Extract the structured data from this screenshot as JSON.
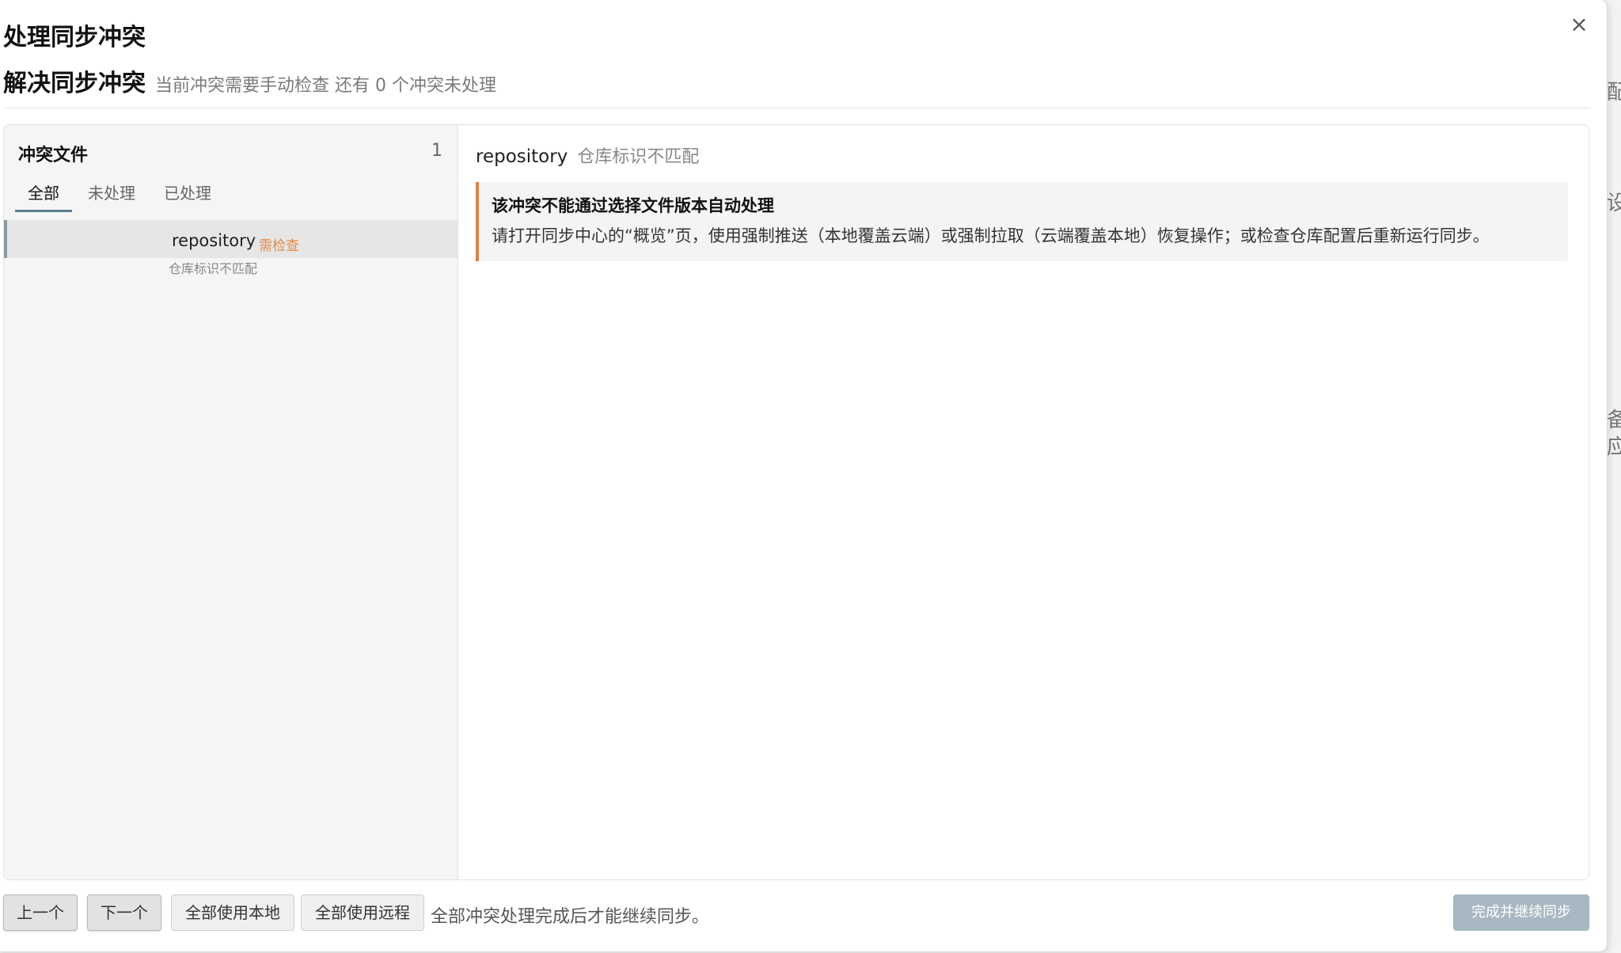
{
  "dialog": {
    "title": "处理同步冲突",
    "close_glyph": "×"
  },
  "heading": {
    "main": "解决同步冲突",
    "sub": "当前冲突需要手动检查  还有 0 个冲突未处理"
  },
  "file_list": {
    "title": "冲突文件",
    "count": "1",
    "tabs": [
      "全部",
      "未处理",
      "已处理"
    ],
    "active_tab": "全部",
    "items": [
      {
        "name": "repository",
        "badge": "需检查",
        "reason": "仓库标识不匹配",
        "badge_color": "#e08a4a"
      }
    ]
  },
  "detail": {
    "name": "repository",
    "reason": "仓库标识不匹配",
    "notice_title": "该冲突不能通过选择文件版本自动处理",
    "notice_body": "请打开同步中心的“概览”页，使用强制推送（本地覆盖云端）或强制拉取（云端覆盖本地）恢复操作；或检查仓库配置后重新运行同步。",
    "notice_accent": "#d9824a"
  },
  "footer": {
    "prev_label": "上一个",
    "next_label": "下一个",
    "use_local_all": "全部使用本地",
    "use_remote_all": "全部使用远程",
    "hint": "全部冲突处理完成后才能继续同步。",
    "finish_label": "完成并继续同步"
  },
  "icons": {
    "close": "close-icon"
  }
}
